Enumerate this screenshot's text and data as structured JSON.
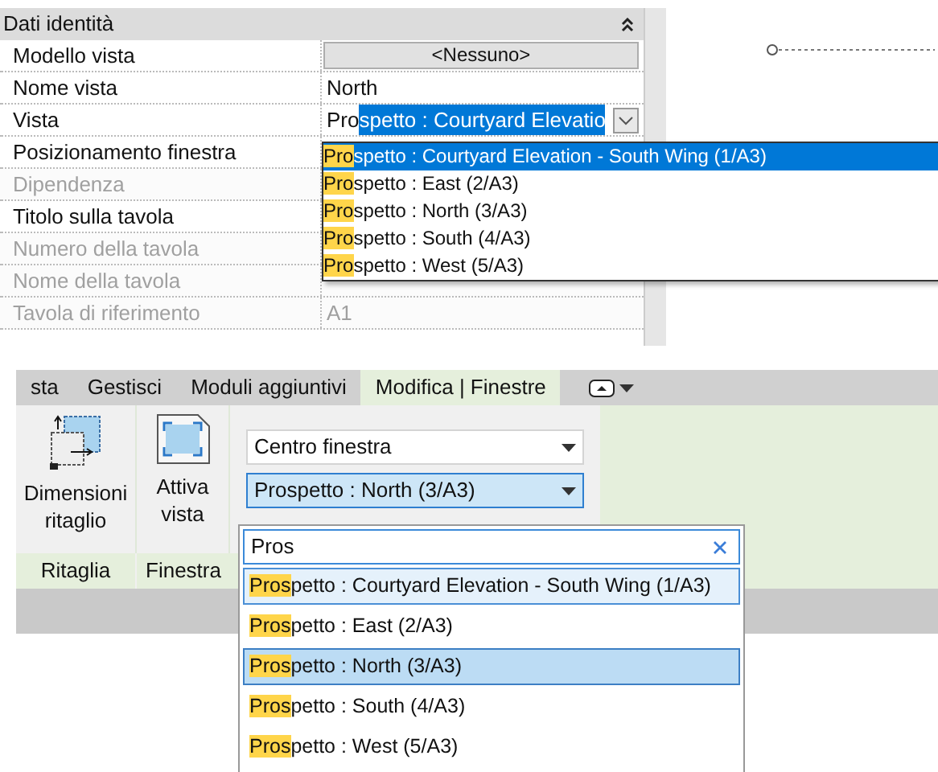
{
  "properties": {
    "section": "Dati identità",
    "rows": [
      {
        "label": "Modello vista",
        "value": "<Nessuno>",
        "kind": "button",
        "disabled": false
      },
      {
        "label": "Nome vista",
        "value": "North",
        "kind": "text",
        "disabled": false
      },
      {
        "label": "Vista",
        "value": "Pro",
        "selected_value": "spetto : Courtyard Elevatio",
        "kind": "combo",
        "disabled": false
      },
      {
        "label": "Posizionamento finestra",
        "kind": "empty",
        "disabled": false
      },
      {
        "label": "Dipendenza",
        "kind": "empty",
        "disabled": true
      },
      {
        "label": "Titolo sulla tavola",
        "kind": "empty",
        "disabled": false
      },
      {
        "label": "Numero della tavola",
        "kind": "empty",
        "disabled": true
      },
      {
        "label": "Nome della tavola",
        "kind": "empty",
        "disabled": true
      },
      {
        "label": "Tavola di riferimento",
        "value": "A1",
        "kind": "text",
        "disabled": true
      }
    ],
    "dropdown": [
      {
        "match": "Pro",
        "rest": "spetto : Courtyard Elevation - South Wing (1/A3)",
        "selected": true
      },
      {
        "match": "Pro",
        "rest": "spetto : East (2/A3)",
        "selected": false
      },
      {
        "match": "Pro",
        "rest": "spetto : North (3/A3)",
        "selected": false
      },
      {
        "match": "Pro",
        "rest": "spetto : South (4/A3)",
        "selected": false
      },
      {
        "match": "Pro",
        "rest": "spetto : West (5/A3)",
        "selected": false
      }
    ]
  },
  "ribbon": {
    "tabs": [
      {
        "label": "sta",
        "selected": false
      },
      {
        "label": "Gestisci",
        "selected": false
      },
      {
        "label": "Moduli aggiuntivi",
        "selected": false
      },
      {
        "label": "Modifica | Finestre",
        "selected": true
      }
    ],
    "buttons": [
      {
        "label": "Dimensioni ritaglio",
        "kind": "crop"
      },
      {
        "label": "Attiva vista",
        "kind": "activate"
      }
    ],
    "panels": [
      "Ritaglia",
      "Finestra"
    ],
    "combos": [
      {
        "value": "Centro finestra",
        "focused": false
      },
      {
        "value": "Prospetto : North (3/A3)",
        "focused": true
      }
    ],
    "list": {
      "search": "Pros",
      "items": [
        {
          "match": "Pros",
          "rest": "petto : Courtyard Elevation - South Wing (1/A3)",
          "selected": false,
          "hovered": true
        },
        {
          "match": "Pros",
          "rest": "petto : East (2/A3)",
          "selected": false,
          "hovered": false
        },
        {
          "match": "Pros",
          "rest": "petto : North (3/A3)",
          "selected": true,
          "hovered": false
        },
        {
          "match": "Pros",
          "rest": "petto : South (4/A3)",
          "selected": false,
          "hovered": false
        },
        {
          "match": "Pros",
          "rest": "petto : West (5/A3)",
          "selected": false,
          "hovered": false
        }
      ]
    }
  }
}
